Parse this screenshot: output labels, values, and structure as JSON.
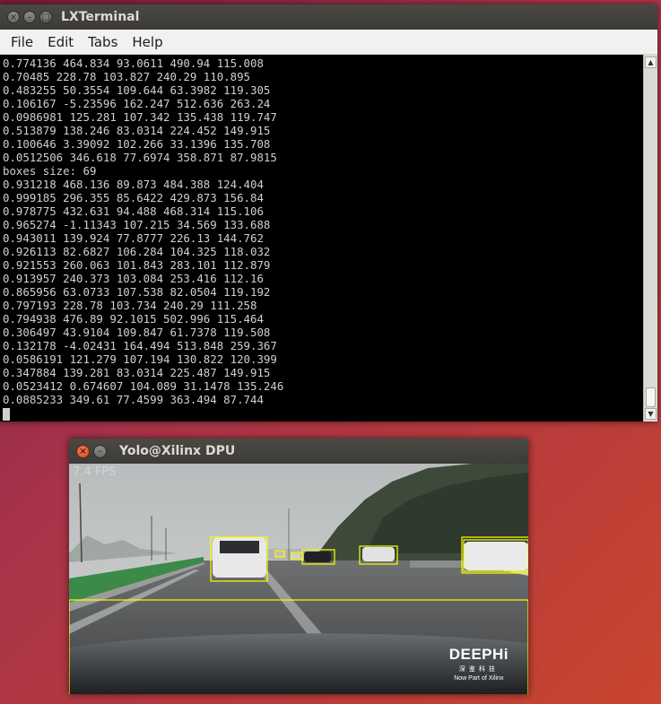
{
  "terminal": {
    "title": "LXTerminal",
    "menu": [
      "File",
      "Edit",
      "Tabs",
      "Help"
    ],
    "lines": [
      "0.774136 464.834 93.0611 490.94 115.008",
      "0.70485 228.78 103.827 240.29 110.895",
      "0.483255 50.3554 109.644 63.3982 119.305",
      "0.106167 -5.23596 162.247 512.636 263.24",
      "0.0986981 125.281 107.342 135.438 119.747",
      "0.513879 138.246 83.0314 224.452 149.915",
      "0.100646 3.39092 102.266 33.1396 135.708",
      "0.0512506 346.618 77.6974 358.871 87.9815",
      "boxes size: 69",
      "0.931218 468.136 89.873 484.388 124.404",
      "0.999185 296.355 85.6422 429.873 156.84",
      "0.978775 432.631 94.488 468.314 115.106",
      "0.965274 -1.11343 107.215 34.569 133.688",
      "0.943011 139.924 77.8777 226.13 144.762",
      "0.926113 82.6827 106.284 104.325 118.032",
      "0.921553 260.063 101.843 283.101 112.879",
      "0.913957 240.373 103.084 253.416 112.16",
      "0.865956 63.0733 107.538 82.0504 119.192",
      "0.797193 228.78 103.734 240.29 111.258",
      "0.794938 476.89 92.1015 502.996 115.464",
      "0.306497 43.9104 109.847 61.7378 119.508",
      "0.132178 -4.02431 164.494 513.848 259.367",
      "0.0586191 121.279 107.194 130.822 120.399",
      "0.347884 139.281 83.0314 225.487 149.915",
      "0.0523412 0.674607 104.089 31.1478 135.246",
      "0.0885233 349.61 77.4599 363.494 87.744"
    ]
  },
  "yolo": {
    "title": "Yolo@Xilinx DPU",
    "fps": "7.4 FPS",
    "logo": {
      "name": "DEEPHi",
      "chinese": "深鉴科技",
      "tagline": "Now Part of Xilinx"
    },
    "box_color": "#ffff00"
  }
}
